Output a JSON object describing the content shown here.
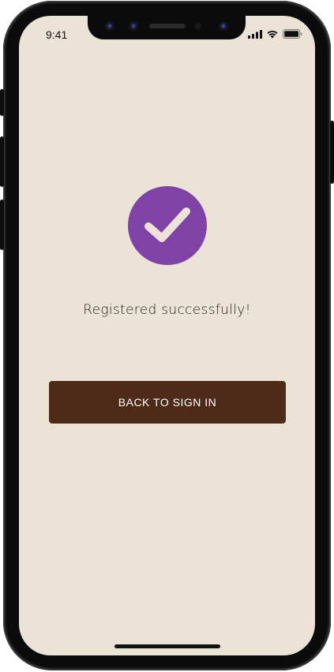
{
  "status_bar": {
    "time": "9:41",
    "icons": [
      "cellular-signal-icon",
      "wifi-icon",
      "battery-icon"
    ]
  },
  "success": {
    "icon": "checkmark-icon",
    "icon_color": "#7f43a8",
    "message": "Registered successfully!"
  },
  "actions": {
    "back_to_sign_in_label": "BACK TO SIGN IN",
    "button_color": "#4e2b19"
  },
  "theme": {
    "background": "#ece3d7"
  }
}
